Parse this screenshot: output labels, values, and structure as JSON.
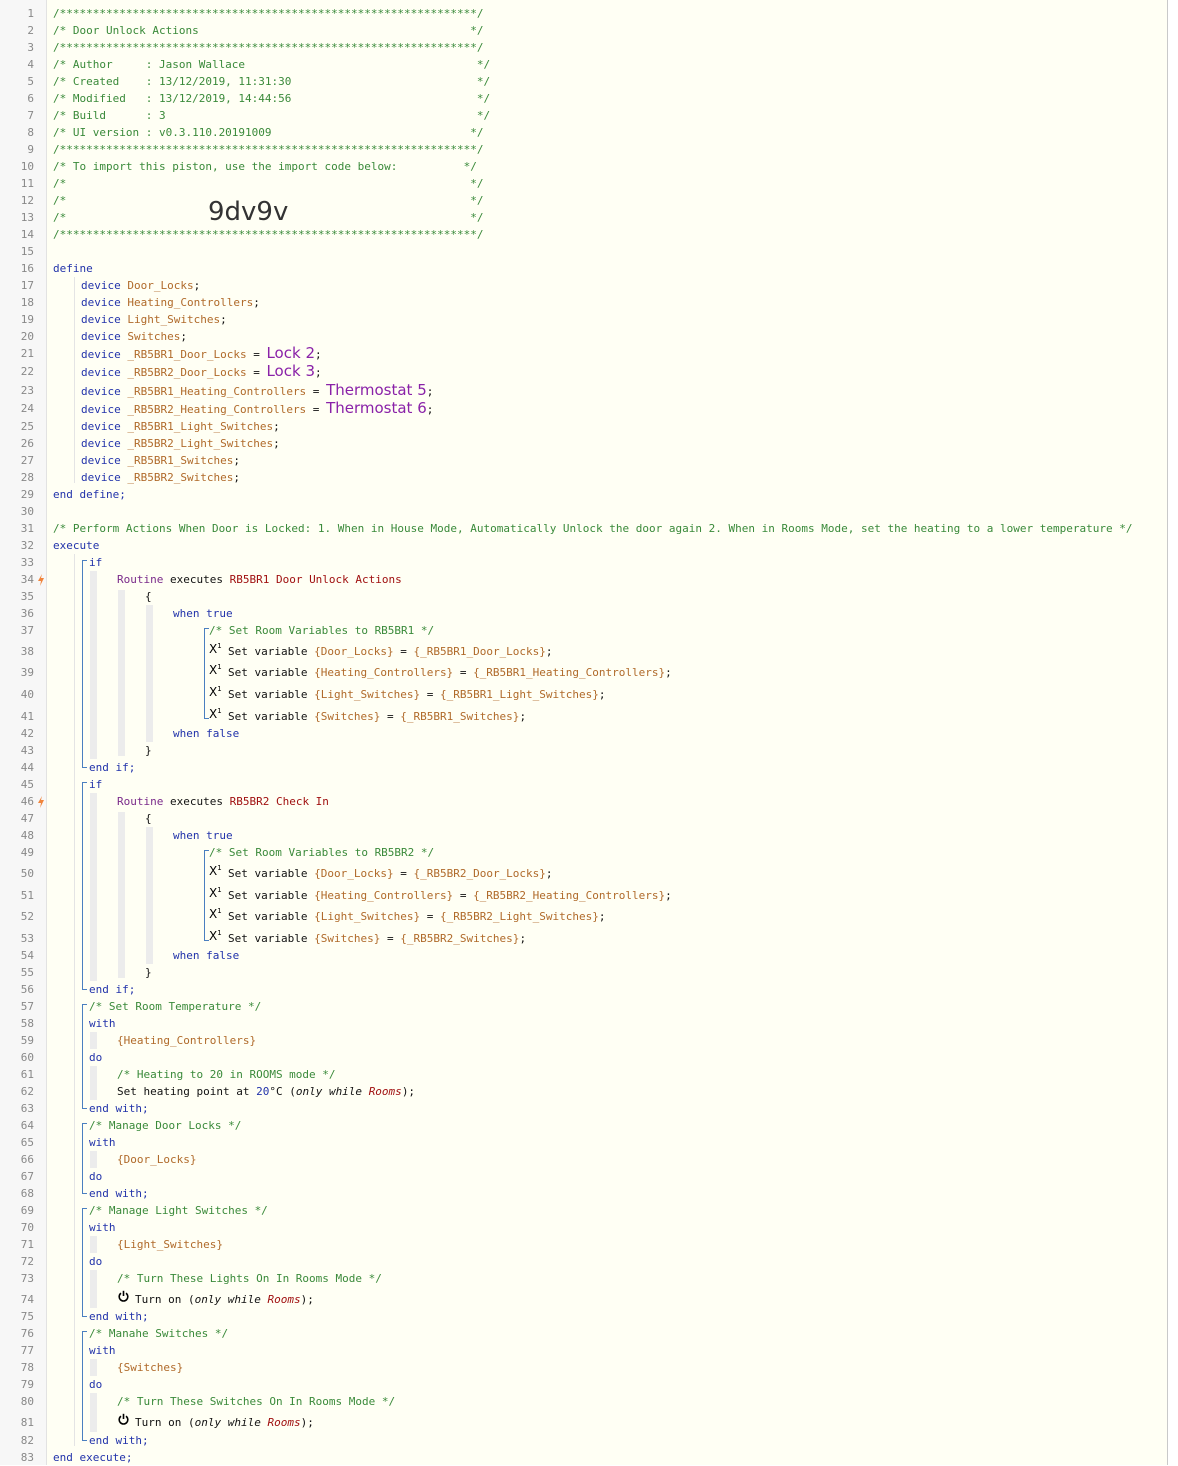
{
  "header": {
    "sep": "/***************************************************************/",
    "title": "/* Door Unlock Actions                                         */",
    "author": "/* Author     : Jason Wallace                                   */",
    "created": "/* Created    : 13/12/2019, 11:31:30                            */",
    "modified": "/* Modified   : 13/12/2019, 14:44:56                            */",
    "build": "/* Build      : 3                                               */",
    "ui_version": "/* UI version : v0.3.110.20191009                              */",
    "import_note": "/* To import this piston, use the import code below:          */",
    "blank": "/*                                                             */",
    "import_code": "9dv9v"
  },
  "define": {
    "open": "define",
    "close": "end define;",
    "device_kw": "device",
    "devices": [
      {
        "name": "Door_Locks",
        "value": ""
      },
      {
        "name": "Heating_Controllers",
        "value": ""
      },
      {
        "name": "Light_Switches",
        "value": ""
      },
      {
        "name": "Switches",
        "value": ""
      },
      {
        "name": "_RB5BR1_Door_Locks",
        "value": "Lock 2"
      },
      {
        "name": "_RB5BR2_Door_Locks",
        "value": "Lock 3"
      },
      {
        "name": "_RB5BR1_Heating_Controllers",
        "value": "Thermostat 5"
      },
      {
        "name": "_RB5BR2_Heating_Controllers",
        "value": "Thermostat 6"
      },
      {
        "name": "_RB5BR1_Light_Switches",
        "value": ""
      },
      {
        "name": "_RB5BR2_Light_Switches",
        "value": ""
      },
      {
        "name": "_RB5BR1_Switches",
        "value": ""
      },
      {
        "name": "_RB5BR2_Switches",
        "value": ""
      }
    ]
  },
  "execute": {
    "comment": "/* Perform Actions When Door is Locked: 1. When in House Mode, Automatically Unlock the door again 2. When in Rooms Mode, set the heating to a lower temperature */",
    "open": "execute",
    "close": "end execute;",
    "if_kw": "if",
    "end_if": "end if;",
    "routine_kw": "Routine",
    "executes_kw": "executes",
    "brace_open": "{",
    "brace_close": "}",
    "when_true": "when true",
    "when_false": "when false",
    "set_variable": "Set variable",
    "eq": "=",
    "if1": {
      "routine": "RB5BR1 Door Unlock Actions",
      "comment": "/* Set Room Variables to RB5BR1 */",
      "sets": [
        {
          "var": "{Door_Locks}",
          "value": "{_RB5BR1_Door_Locks}"
        },
        {
          "var": "{Heating_Controllers}",
          "value": "{_RB5BR1_Heating_Controllers}"
        },
        {
          "var": "{Light_Switches}",
          "value": "{_RB5BR1_Light_Switches}"
        },
        {
          "var": "{Switches}",
          "value": "{_RB5BR1_Switches}"
        }
      ]
    },
    "if2": {
      "routine": "RB5BR2 Check In",
      "comment": "/* Set Room Variables to RB5BR2 */",
      "sets": [
        {
          "var": "{Door_Locks}",
          "value": "{_RB5BR2_Door_Locks}"
        },
        {
          "var": "{Heating_Controllers}",
          "value": "{_RB5BR2_Heating_Controllers}"
        },
        {
          "var": "{Light_Switches}",
          "value": "{_RB5BR2_Light_Switches}"
        },
        {
          "var": "{Switches}",
          "value": "{_RB5BR2_Switches}"
        }
      ]
    },
    "with_kw": "with",
    "do_kw": "do",
    "end_with": "end with;",
    "only_while": "only while",
    "rooms": "Rooms",
    "with1": {
      "comment": "/* Set Room Temperature */",
      "device": "{Heating_Controllers}",
      "action_comment": "/* Heating to 20 in ROOMS mode */",
      "action": "Set heating point at",
      "temp": "20",
      "unit": "°C"
    },
    "with2": {
      "comment": "/* Manage Door Locks */",
      "device": "{Door_Locks}"
    },
    "with3": {
      "comment": "/* Manage Light Switches */",
      "device": "{Light_Switches}",
      "action_comment": "/* Turn These Lights On In Rooms Mode */",
      "action": "Turn on"
    },
    "with4": {
      "comment": "/* Manahe Switches */",
      "device": "{Switches}",
      "action_comment": "/* Turn These Switches On In Rooms Mode */",
      "action": "Turn on"
    }
  },
  "gutter": {
    "line_numbers": [
      "1",
      "2",
      "3",
      "4",
      "5",
      "6",
      "7",
      "8",
      "9",
      "10",
      "11",
      "12",
      "13",
      "14",
      "15",
      "16",
      "17",
      "18",
      "19",
      "20",
      "21",
      "22",
      "23",
      "24",
      "25",
      "26",
      "27",
      "28",
      "29",
      "30",
      "31",
      "32",
      "33",
      "34",
      "35",
      "36",
      "37",
      "38",
      "39",
      "40",
      "41",
      "42",
      "43",
      "44",
      "45",
      "46",
      "47",
      "48",
      "49",
      "50",
      "51",
      "52",
      "53",
      "54",
      "55",
      "56",
      "57",
      "58",
      "59",
      "60",
      "61",
      "62",
      "63",
      "64",
      "65",
      "66",
      "67",
      "68",
      "69",
      "70",
      "71",
      "72",
      "73",
      "74",
      "75",
      "76",
      "77",
      "78",
      "79",
      "80",
      "81",
      "82",
      "83"
    ],
    "trigger_lines": [
      "34",
      "46"
    ],
    "trigger_color": "#f0843c"
  },
  "colors": {
    "comment": "#3a8a3a",
    "keyword": "#2233aa",
    "variable": "#b06a2a",
    "value": "#8a22a8",
    "routine": "#a01010",
    "block_line": "#4a7fc0"
  }
}
